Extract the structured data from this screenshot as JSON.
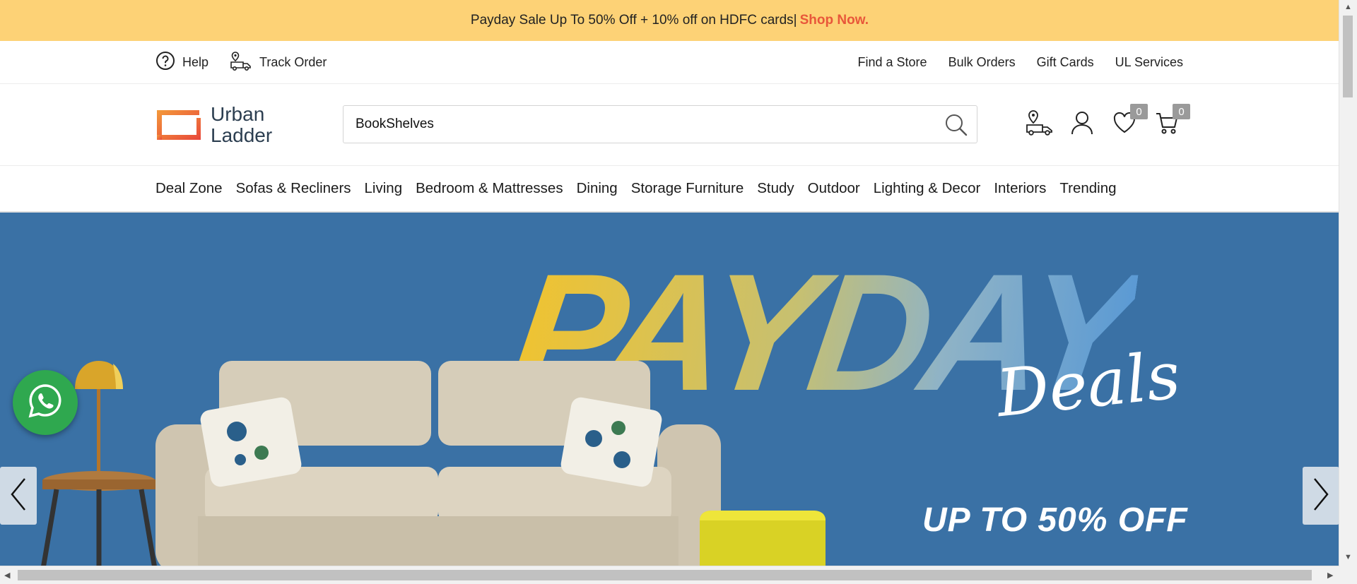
{
  "promo": {
    "text": "Payday Sale Up To 50% Off + 10% off on HDFC cards|",
    "link": "Shop Now."
  },
  "utility": {
    "help": "Help",
    "track": "Track Order",
    "right": [
      "Find a Store",
      "Bulk Orders",
      "Gift Cards",
      "UL Services"
    ]
  },
  "logo": {
    "line1": "Urban",
    "line2": "Ladder"
  },
  "search": {
    "value": "BookShelves"
  },
  "header_icons": {
    "wishlist_count": "0",
    "cart_count": "0"
  },
  "nav": [
    "Deal Zone",
    "Sofas & Recliners",
    "Living",
    "Bedroom & Mattresses",
    "Dining",
    "Storage Furniture",
    "Study",
    "Outdoor",
    "Lighting & Decor",
    "Interiors",
    "Trending"
  ],
  "hero": {
    "headline": "PAYDAY",
    "script": "Deals",
    "offer": "UP TO 50% OFF"
  },
  "colors": {
    "promo_bg": "#fdd276",
    "shop_now": "#e8573a",
    "hero_bg": "#3a71a5",
    "logo_orange": "#f07330",
    "whatsapp": "#2fa84f"
  }
}
